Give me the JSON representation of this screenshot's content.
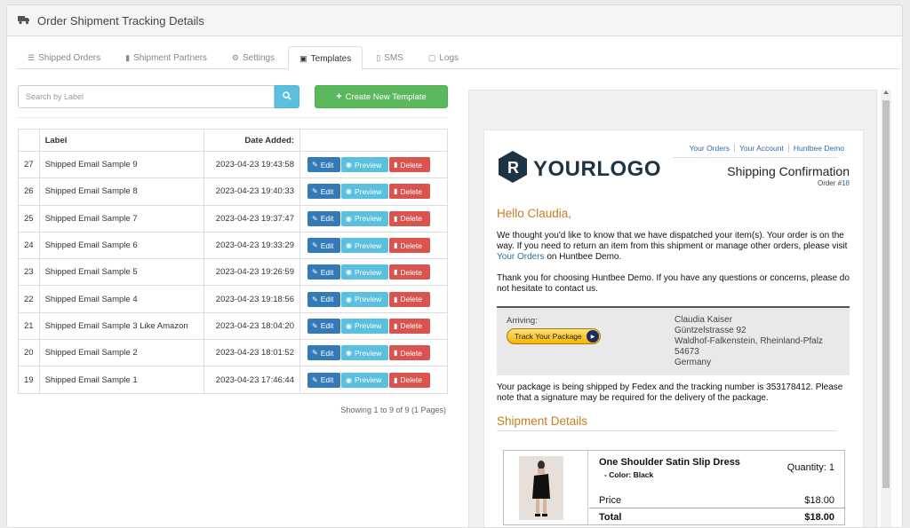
{
  "header": {
    "title": "Order Shipment Tracking Details",
    "icon": "truck-icon"
  },
  "tabs": [
    {
      "label": "Shipped Orders",
      "icon": "list-icon",
      "active": false
    },
    {
      "label": "Shipment Partners",
      "icon": "truck-icon",
      "active": false
    },
    {
      "label": "Settings",
      "icon": "gears-icon",
      "active": false
    },
    {
      "label": "Templates",
      "icon": "inbox-icon",
      "active": true
    },
    {
      "label": "SMS",
      "icon": "mobile-icon",
      "active": false
    },
    {
      "label": "Logs",
      "icon": "file-icon",
      "active": false
    }
  ],
  "search": {
    "placeholder": "Search by Label"
  },
  "create_button": "Create New Template",
  "table": {
    "headers": {
      "label": "Label",
      "date": "Date Added:"
    },
    "actions": {
      "edit": "Edit",
      "preview": "Preview",
      "delete": "Delete"
    },
    "rows": [
      {
        "id": "27",
        "label": "Shipped Email Sample 9",
        "date": "2023-04-23 19:43:58"
      },
      {
        "id": "26",
        "label": "Shipped Email Sample 8",
        "date": "2023-04-23 19:40:33"
      },
      {
        "id": "25",
        "label": "Shipped Email Sample 7",
        "date": "2023-04-23 19:37:47"
      },
      {
        "id": "24",
        "label": "Shipped Email Sample 6",
        "date": "2023-04-23 19:33:29"
      },
      {
        "id": "23",
        "label": "Shipped Email Sample 5",
        "date": "2023-04-23 19:26:59"
      },
      {
        "id": "22",
        "label": "Shipped Email Sample 4",
        "date": "2023-04-23 19:18:56"
      },
      {
        "id": "21",
        "label": "Shipped Email Sample 3 Like Amazon",
        "date": "2023-04-23 18:04:20"
      },
      {
        "id": "20",
        "label": "Shipped Email Sample 2",
        "date": "2023-04-23 18:01:52"
      },
      {
        "id": "19",
        "label": "Shipped Email Sample 1",
        "date": "2023-04-23 17:46:44"
      }
    ],
    "showing": "Showing 1 to 9 of 9 (1 Pages)"
  },
  "email": {
    "links": [
      "Your Orders",
      "Your Account",
      "Huntbee Demo"
    ],
    "logo_text": "YOURLOGO",
    "title": "Shipping Confirmation",
    "order_prefix": "Order #",
    "order_number": "18",
    "greeting": "Hello Claudia,",
    "para1_text": "We thought you'd like to know that we have dispatched your item(s). Your order is on the way. If you need to return an item from this shipment or manage other orders, please visit ",
    "para1_link": "Your Orders",
    "para1_end": " on Huntbee Demo.",
    "para2": "Thank you for choosing Huntbee Demo. If you have any questions or concerns, please do not hesitate to contact us.",
    "arriving_label": "Arriving:",
    "track_button": "Track Your Package",
    "address": [
      "Claudia Kaiser",
      "Güntzelstrasse 92",
      "Waldhof-Falkenstein, Rheinland-Pfalz",
      "54673",
      "Germany"
    ],
    "para3": "Your package is being shipped by Fedex and the tracking number is 353178412. Please note that a signature may be required for the delivery of the package.",
    "details_title": "Shipment Details",
    "product": {
      "name": "One Shoulder Satin Slip Dress",
      "option": "- Color: Black",
      "quantity": "Quantity: 1",
      "price_label": "Price",
      "price": "$18.00",
      "total_label": "Total",
      "total": "$18.00"
    }
  },
  "colors": {
    "accent_orange": "#c67d1f",
    "link_blue": "#2e6da4",
    "btn_edit": "#337ab7",
    "btn_preview": "#5bc0de",
    "btn_delete": "#d9534f",
    "btn_create": "#5cb85c"
  }
}
